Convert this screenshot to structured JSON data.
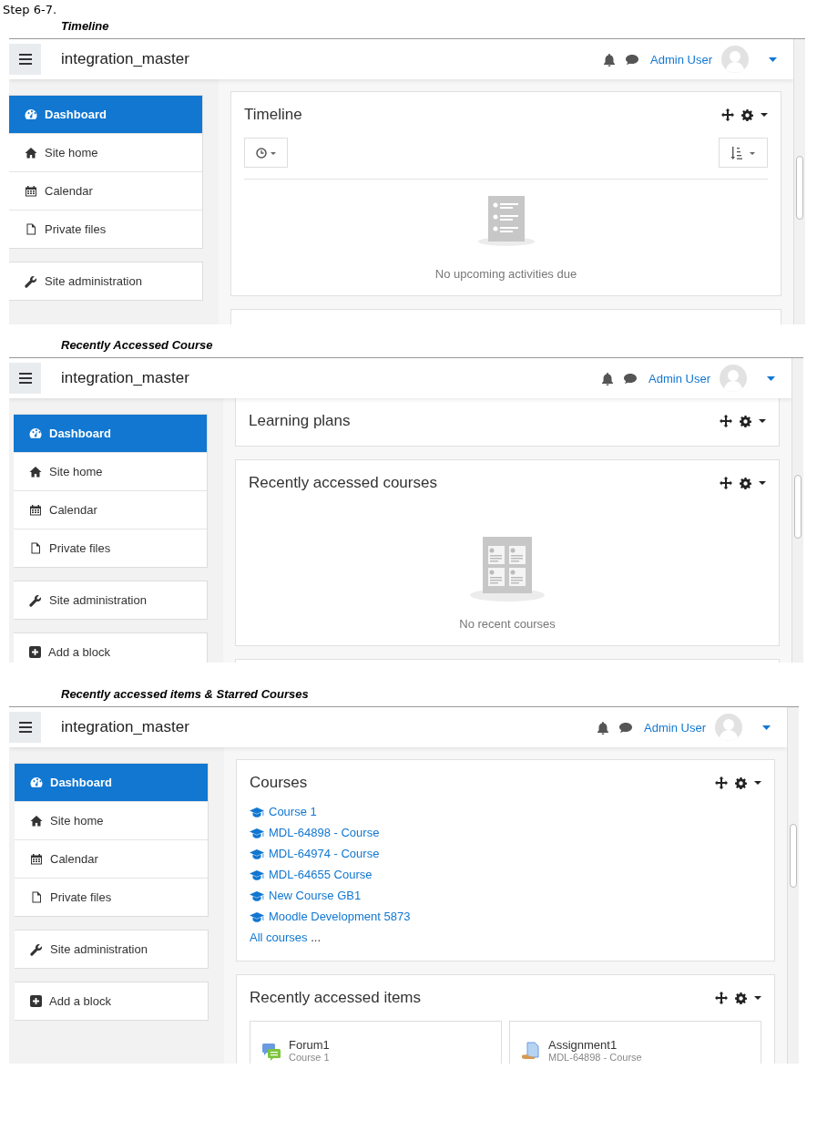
{
  "step": "Step 6-7.",
  "sections": [
    {
      "caption": "Timeline",
      "screen": {
        "site_name": "integration_master",
        "user_name": "Admin User",
        "nav": [
          {
            "label": "Dashboard",
            "selected": true
          },
          {
            "label": "Site home",
            "selected": false
          },
          {
            "label": "Calendar",
            "selected": false
          },
          {
            "label": "Private files",
            "selected": false
          }
        ],
        "nav_extra": [
          "Site administration"
        ],
        "blocks": [
          {
            "kind": "timeline",
            "title": "Timeline",
            "empty_text": "No upcoming activities due"
          },
          {
            "kind": "blank"
          }
        ]
      }
    },
    {
      "caption": "Recently Accessed Course",
      "screen": {
        "site_name": "integration_master",
        "user_name": "Admin User",
        "nav": [
          {
            "label": "Dashboard",
            "selected": true
          },
          {
            "label": "Site home",
            "selected": false
          },
          {
            "label": "Calendar",
            "selected": false
          },
          {
            "label": "Private files",
            "selected": false
          }
        ],
        "nav_extra": [
          "Site administration",
          "Add a block"
        ],
        "blocks": [
          {
            "kind": "plain",
            "title": "Learning plans"
          },
          {
            "kind": "recent_courses",
            "title": "Recently accessed courses",
            "empty_text": "No recent courses"
          },
          {
            "kind": "blank"
          }
        ]
      }
    },
    {
      "caption": "Recently accessed items & Starred Courses",
      "screen": {
        "site_name": "integration_master",
        "user_name": "Admin User",
        "nav": [
          {
            "label": "Dashboard",
            "selected": true
          },
          {
            "label": "Site home",
            "selected": false
          },
          {
            "label": "Calendar",
            "selected": false
          },
          {
            "label": "Private files",
            "selected": false
          }
        ],
        "nav_extra": [
          "Site administration",
          "Add a block"
        ],
        "blocks": [
          {
            "kind": "course_list",
            "title": "Courses",
            "courses": [
              "Course 1",
              "MDL-64898 - Course",
              "MDL-64974 - Course",
              "MDL-64655 Course",
              "New Course GB1",
              "Moodle Development 5873"
            ],
            "all_link": "All courses",
            "all_suffix": "..."
          },
          {
            "kind": "recent_items",
            "title": "Recently accessed items",
            "items": [
              {
                "kind": "forum",
                "name": "Forum1",
                "course": "Course 1"
              },
              {
                "kind": "assignment",
                "name": "Assignment1",
                "course": "MDL-64898 - Course"
              }
            ]
          }
        ]
      }
    }
  ]
}
